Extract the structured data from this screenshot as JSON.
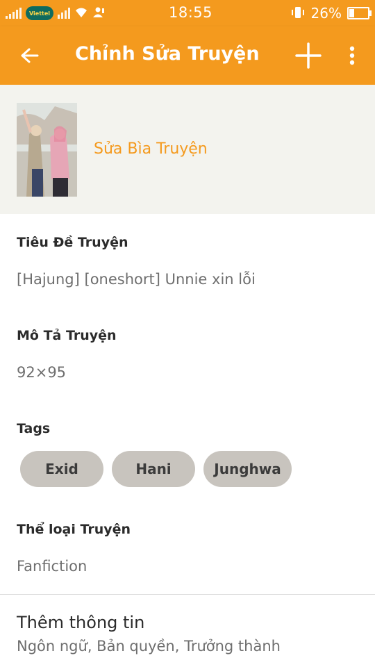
{
  "status_bar": {
    "time": "18:55",
    "battery_percent": "26%",
    "battery_level": 0.26,
    "carrier_logo": "Viettel",
    "icons": [
      "signal-icon",
      "carrier-logo",
      "signal-icon",
      "wifi-icon",
      "user-icon",
      "vibrate-icon",
      "battery-icon"
    ]
  },
  "toolbar": {
    "title": "Chỉnh Sửa Truyện",
    "back_icon": "back-arrow-icon",
    "add_icon": "plus-icon",
    "more_icon": "more-vertical-icon",
    "color": "#f49a1e"
  },
  "cover": {
    "edit_label": "Sửa Bìa Truyện"
  },
  "story": {
    "title_label": "Tiêu Đề Truyện",
    "title_value": "[Hajung] [oneshort] Unnie xin lỗi",
    "description_label": "Mô Tả Truyện",
    "description_value": "92×95",
    "tags_label": "Tags",
    "tags": [
      "Exid",
      "Hani",
      "Junghwa"
    ],
    "category_label": "Thể loại Truyện",
    "category_value": "Fanfiction"
  },
  "more_info": {
    "title": "Thêm thông tin",
    "subtitle": "Ngôn ngữ, Bản quyền, Trưởng thành"
  }
}
